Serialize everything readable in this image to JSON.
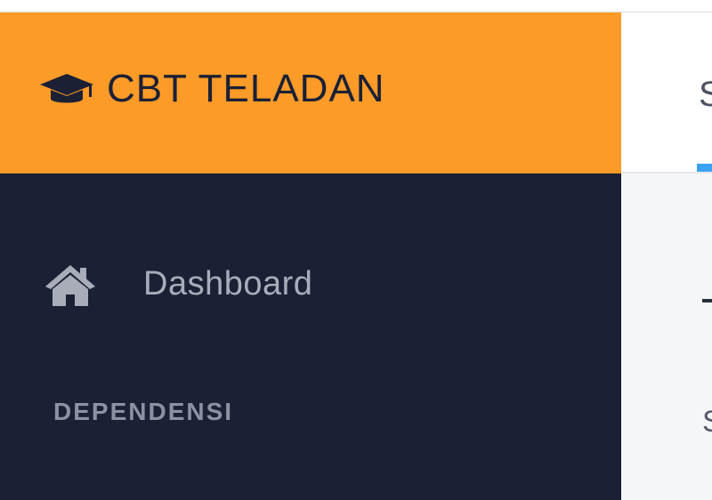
{
  "brand": {
    "title": "CBT TELADAN",
    "icon": "graduation-cap-icon",
    "background_color": "#fd9b28",
    "text_color": "#1b2035"
  },
  "sidebar": {
    "background_color": "#1b2035",
    "items": [
      {
        "label": "Dashboard",
        "icon": "home-icon"
      }
    ],
    "section_header": "DEPENDENSI"
  },
  "main": {
    "header_text_partial": "S",
    "body_text_partial": "S",
    "accent_color": "#3aa2f2"
  }
}
